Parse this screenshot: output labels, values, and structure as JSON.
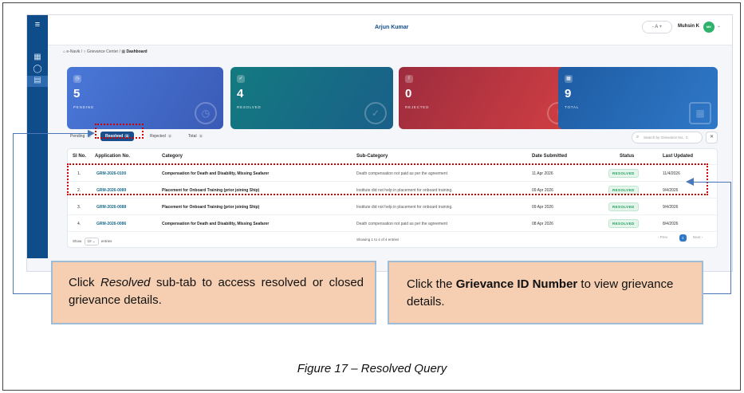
{
  "app": {
    "header_title": "Arjun Kumar",
    "font_controls": "- A +",
    "user_name": "Muhsin K",
    "avatar_initials": "MK"
  },
  "breadcrumb": {
    "items": [
      "e-Navik",
      "Grievance Center",
      "Dashboard"
    ]
  },
  "stat_cards": [
    {
      "value": "5",
      "label": "PENDING",
      "color": "#4a78d8"
    },
    {
      "value": "4",
      "label": "RESOLVED",
      "color": "#137a80"
    },
    {
      "value": "0",
      "label": "REJECTED",
      "color": "#d23f43"
    },
    {
      "value": "9",
      "label": "TOTAL",
      "color": "#2f78c8"
    }
  ],
  "tabs": [
    {
      "label": "Pending",
      "count": "5"
    },
    {
      "label": "Resolved",
      "count": "4",
      "active": true
    },
    {
      "label": "Rejected",
      "count": "0"
    },
    {
      "label": "Total",
      "count": "9"
    }
  ],
  "search": {
    "placeholder": "Search by Grievance No., C"
  },
  "table": {
    "headers": [
      "Sl No.",
      "Application No.",
      "Category",
      "Sub-Category",
      "Date Submitted",
      "Status",
      "Last Updated"
    ],
    "rows": [
      {
        "sl": "1.",
        "app": "GRM-2026-0100",
        "category": "Compensation for Death and Disability, Missing Seafarer",
        "sub": "Death compensation not paid as per the agreement",
        "date": "11 Apr 2026",
        "status": "RESOLVED",
        "updated": "11/4/2026"
      },
      {
        "sl": "2.",
        "app": "GRM-2026-0089",
        "category": "Placement for Onboard Training (prior joining Ship)",
        "sub": "Institute did not help in placement for onboard training.",
        "date": "09 Apr 2026",
        "status": "RESOLVED",
        "updated": "9/4/2026"
      },
      {
        "sl": "3.",
        "app": "GRM-2026-0088",
        "category": "Placement for Onboard Training (prior joining Ship)",
        "sub": "Institute did not help in placement for onboard training.",
        "date": "09 Apr 2026",
        "status": "RESOLVED",
        "updated": "9/4/2026"
      },
      {
        "sl": "4.",
        "app": "GRM-2026-0086",
        "category": "Compensation for Death and Disability, Missing Seafarer",
        "sub": "Death compensation not paid as per the agreement",
        "date": "08 Apr 2026",
        "status": "RESOLVED",
        "updated": "8/4/2026"
      }
    ],
    "show_label": "Show",
    "show_value": "10",
    "entries_label": "entries",
    "showing_text": "Showing 1 to 4 of 4 entries",
    "prev": "‹ Prev",
    "page": "1",
    "next": "Next ›"
  },
  "callouts": {
    "left_pre": "Click ",
    "left_em": "Resolved",
    "left_post": " sub-tab to access resolved or closed grievance details.",
    "right_pre": "Click the ",
    "right_strong": "Grievance ID Number",
    "right_post": " to view grievance details."
  },
  "caption": "Figure 17 – Resolved Query"
}
